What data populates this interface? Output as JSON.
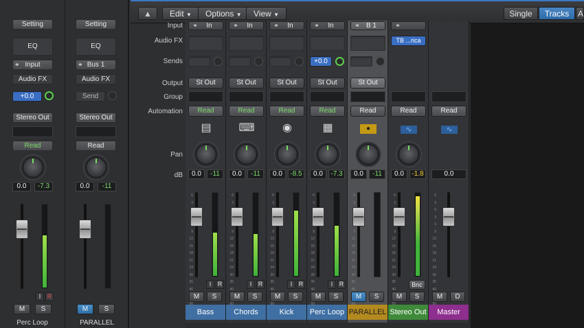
{
  "toolbar": {
    "edit": "Edit",
    "options": "Options",
    "view": "View",
    "single": "Single",
    "tracks": "Tracks",
    "all": "A"
  },
  "row_labels": {
    "input": "Input",
    "audio_fx": "Audio FX",
    "sends": "Sends",
    "output": "Output",
    "group": "Group",
    "automation": "Automation",
    "pan": "Pan",
    "db": "dB"
  },
  "inspector": {
    "left": {
      "setting": "Setting",
      "eq": "EQ",
      "input": "Input",
      "audio_fx": "Audio FX",
      "send": "+0.0",
      "output": "Stereo Out",
      "automation": "Read",
      "vol": "0.0",
      "peak": "-7.3",
      "mute": "M",
      "solo": "S",
      "input_mon": "I",
      "record": "R",
      "name": "Perc Loop",
      "meter_level": 0.6
    },
    "right": {
      "setting": "Setting",
      "eq": "EQ",
      "input": "Bus 1",
      "audio_fx": "Audio FX",
      "send": "Send",
      "output": "Stereo Out",
      "automation": "Read",
      "vol": "0.0",
      "peak": "-11",
      "mute": "M",
      "solo": "S",
      "name": "PARALLEL",
      "meter_level": 0
    }
  },
  "fader_scale": [
    "6",
    "3",
    "0",
    "3",
    "6",
    "9",
    "12",
    "15",
    "18",
    "21",
    "24",
    "30",
    "35",
    "40",
    "45",
    "50",
    "60"
  ],
  "channels": [
    {
      "name": "Bass",
      "input": "In",
      "output": "St Out",
      "automation": "Read",
      "vol": "0.0",
      "peak": "-11",
      "mute": "M",
      "solo": "S",
      "input_mon": "I",
      "record": "R",
      "icon": "bass-amp-icon",
      "color": "#3f6fa3",
      "meter_level": 0.52
    },
    {
      "name": "Chords",
      "input": "In",
      "output": "St Out",
      "automation": "Read",
      "vol": "0.0",
      "peak": "-11",
      "mute": "M",
      "solo": "S",
      "input_mon": "I",
      "record": "R",
      "icon": "keyboard-stand-icon",
      "color": "#3f6fa3",
      "meter_level": 0.5
    },
    {
      "name": "Kick",
      "input": "In",
      "output": "St Out",
      "automation": "Read",
      "vol": "0.0",
      "peak": "-8.5",
      "mute": "M",
      "solo": "S",
      "input_mon": "I",
      "record": "R",
      "icon": "kick-drum-icon",
      "color": "#3f6fa3",
      "meter_level": 0.78
    },
    {
      "name": "Perc Loop",
      "input": "In",
      "output": "St Out",
      "send": "+0.0",
      "automation": "Read",
      "vol": "0.0",
      "peak": "-7.3",
      "mute": "M",
      "solo": "S",
      "input_mon": "I",
      "record": "R",
      "icon": "drum-machine-icon",
      "color": "#3f6fa3",
      "meter_level": 0.6
    },
    {
      "name": "PARALLEL",
      "input": "B 1",
      "output": "St Out",
      "automation": "Read",
      "vol": "0.0",
      "peak": "-11",
      "mute": "M",
      "solo": "S",
      "icon": "aux-icon",
      "color": "#b38a1e",
      "meter_level": 0
    },
    {
      "name": "Stereo Out",
      "input": "",
      "plugin": "TB ...rica",
      "automation": "Read",
      "vol": "0.0",
      "peak": "-1.8",
      "mute": "M",
      "solo": "S",
      "bounce": "Bnc",
      "icon": "waveform-icon",
      "color": "#3f8a3a",
      "meter_level": 0.95
    },
    {
      "name": "Master",
      "automation": "Read",
      "vol": "0.0",
      "mute": "M",
      "solo": "D",
      "icon": "waveform-icon",
      "color": "#8e2e8e",
      "meter_level": 0
    }
  ]
}
